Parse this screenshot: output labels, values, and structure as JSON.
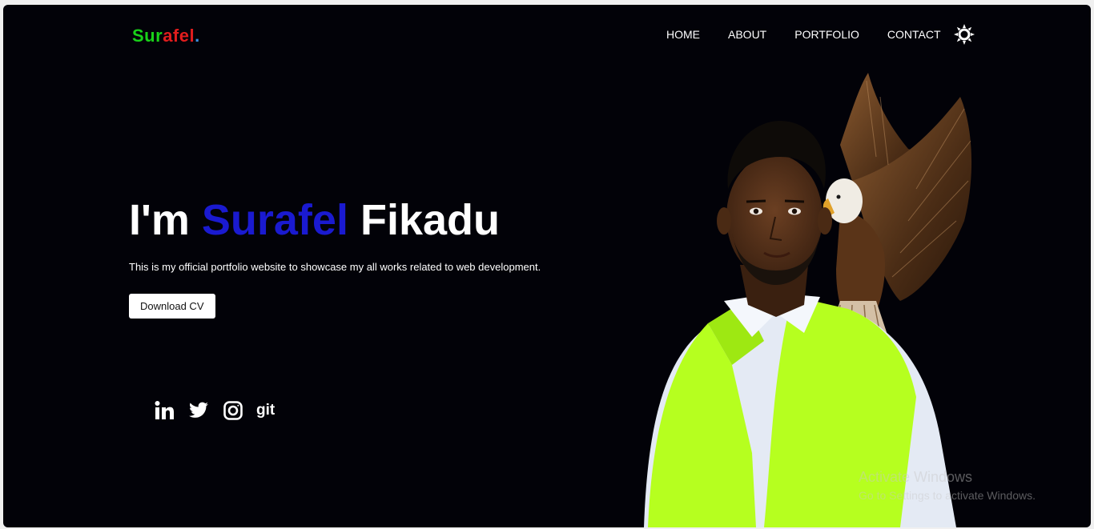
{
  "logo": {
    "part1": "Sur",
    "part2": "afel",
    "part3": "."
  },
  "nav": {
    "items": [
      "HOME",
      "ABOUT",
      "PORTFOLIO",
      "CONTACT"
    ],
    "theme_icon": "sun-icon"
  },
  "hero": {
    "title_prefix": "I'm ",
    "title_name": "Surafel",
    "title_suffix": " Fikadu",
    "description": "This is my official portfolio website to showcase my all works related to web development.",
    "cta_label": "Download CV"
  },
  "socials": {
    "icons": [
      "linkedin-icon",
      "twitter-icon",
      "instagram-icon"
    ],
    "git_label": "git"
  },
  "photo": {
    "subject": "person-with-eagle-photo"
  },
  "watermark": {
    "title": "Activate Windows",
    "subtitle": "Go to Settings to activate Windows."
  },
  "colors": {
    "background": "#020208",
    "accent": "#1a1ad0",
    "logo_green": "#19d219",
    "logo_red": "#e11d1d",
    "logo_blue": "#3b8fe0",
    "vest": "#b6ff1f"
  }
}
